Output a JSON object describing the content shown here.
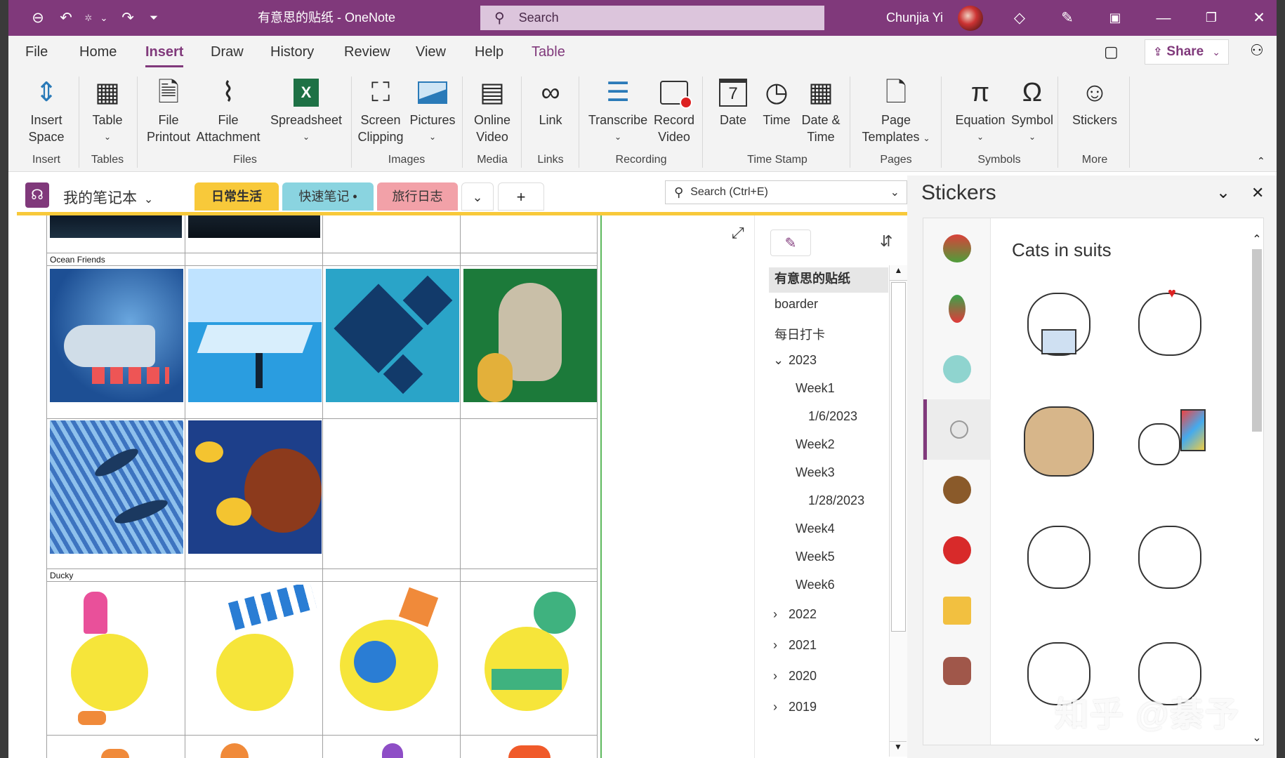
{
  "titlebar": {
    "doc_title": "有意思的贴纸  -  OneNote",
    "search_label": "Search",
    "user": "Chunjia Yi"
  },
  "menu": {
    "tabs": [
      "File",
      "Home",
      "Insert",
      "Draw",
      "History",
      "Review",
      "View",
      "Help",
      "Table"
    ],
    "active": "Insert",
    "share": "Share"
  },
  "ribbon": {
    "buttons": {
      "insert_space": [
        "Insert",
        "Space"
      ],
      "table": [
        "Table"
      ],
      "file_printout": [
        "File",
        "Printout"
      ],
      "file_attachment": [
        "File",
        "Attachment"
      ],
      "spreadsheet": [
        "Spreadsheet"
      ],
      "screen_clipping": [
        "Screen",
        "Clipping"
      ],
      "pictures": [
        "Pictures"
      ],
      "online_video": [
        "Online",
        "Video"
      ],
      "link": [
        "Link"
      ],
      "transcribe": [
        "Transcribe"
      ],
      "record_video": [
        "Record",
        "Video"
      ],
      "date": [
        "Date"
      ],
      "time": [
        "Time"
      ],
      "date_time": [
        "Date &",
        "Time"
      ],
      "page_templates": [
        "Page",
        "Templates"
      ],
      "equation": [
        "Equation"
      ],
      "symbol": [
        "Symbol"
      ],
      "stickers": [
        "Stickers"
      ]
    },
    "groups": {
      "insert": "Insert",
      "tables": "Tables",
      "files": "Files",
      "images": "Images",
      "media": "Media",
      "links": "Links",
      "recording": "Recording",
      "time_stamp": "Time Stamp",
      "pages": "Pages",
      "symbols": "Symbols",
      "more": "More"
    }
  },
  "notebook": {
    "name": "我的笔记本",
    "sections": [
      "日常生活",
      "快速笔记",
      "旅行日志"
    ],
    "active_section": "日常生活",
    "add": "+",
    "search_placeholder": "Search (Ctrl+E)"
  },
  "canvas": {
    "row_labels": [
      "Ocean Friends",
      "Ducky"
    ]
  },
  "pages": {
    "items": [
      {
        "label": "有意思的贴纸",
        "active": true
      },
      {
        "label": "boarder"
      },
      {
        "label": "每日打卡"
      },
      {
        "label": "2023",
        "expanded": true
      },
      {
        "label": "Week1"
      },
      {
        "label": "1/6/2023"
      },
      {
        "label": "Week2"
      },
      {
        "label": "Week3"
      },
      {
        "label": "1/28/2023"
      },
      {
        "label": "Week4"
      },
      {
        "label": "Week5"
      },
      {
        "label": "Week6"
      },
      {
        "label": "2022"
      },
      {
        "label": "2021"
      },
      {
        "label": "2020"
      },
      {
        "label": "2019"
      }
    ]
  },
  "stickers": {
    "title": "Stickers",
    "pack_name": "Cats in suits"
  },
  "watermark": "知乎 @綦予"
}
